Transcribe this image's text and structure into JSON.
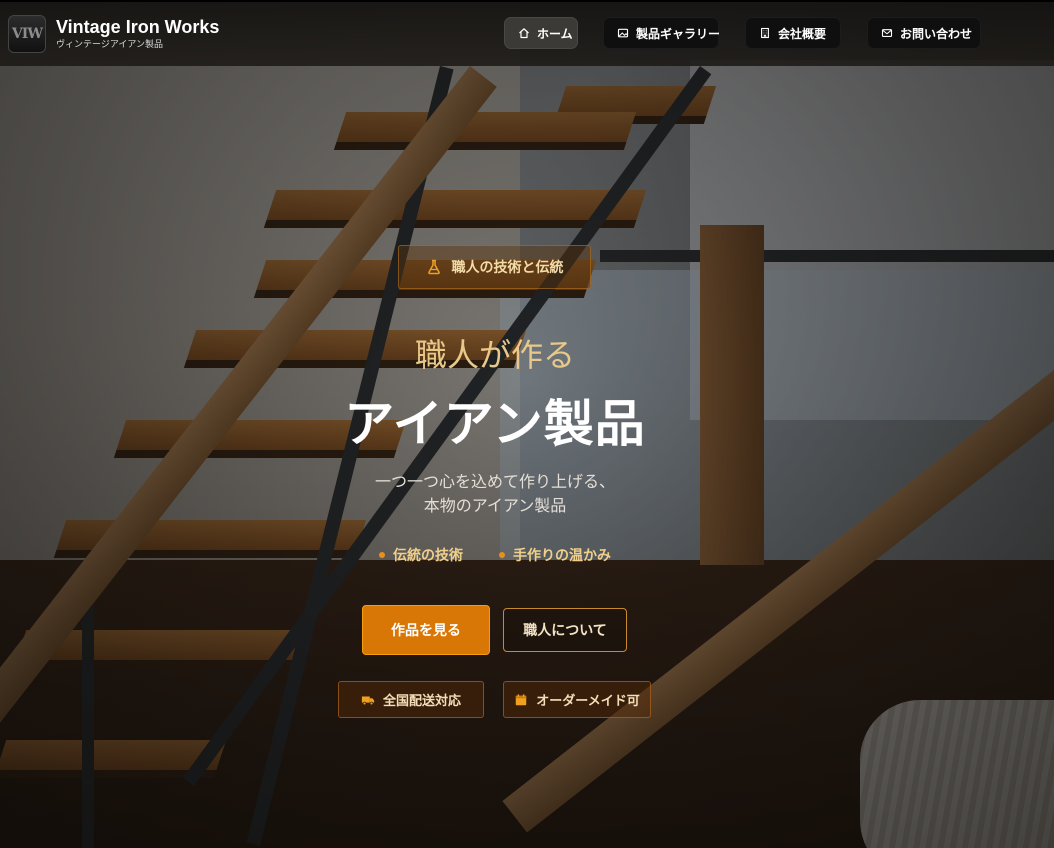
{
  "header": {
    "logo_text": "VIW",
    "brand_title": "Vintage Iron Works",
    "brand_subtitle": "ヴィンテージアイアン製品",
    "nav": [
      {
        "label": "ホーム",
        "icon": "home-icon",
        "active": true
      },
      {
        "label": "製品ギャラリー",
        "icon": "image-icon",
        "active": false
      },
      {
        "label": "会社概要",
        "icon": "building-icon",
        "active": false
      },
      {
        "label": "お問い合わせ",
        "icon": "mail-icon",
        "active": false
      }
    ]
  },
  "hero": {
    "badge": {
      "label": "職人の技術と伝統",
      "icon": "flask-icon"
    },
    "title_line1": "職人が作る",
    "title_line2": "アイアン製品",
    "description_line1": "一つ一つ心を込めて作り上げる、",
    "description_line2": "本物のアイアン製品",
    "features": [
      "伝統の技術",
      "手作りの温かみ"
    ],
    "primary_button": "作品を見る",
    "secondary_button": "職人について",
    "tags": [
      {
        "label": "全国配送対応",
        "icon": "truck-icon"
      },
      {
        "label": "オーダーメイド可",
        "icon": "calendar-icon"
      }
    ]
  },
  "colors": {
    "accent": "#d97706",
    "accent_light": "#e8c98a",
    "header_bg": "#1c1916"
  }
}
